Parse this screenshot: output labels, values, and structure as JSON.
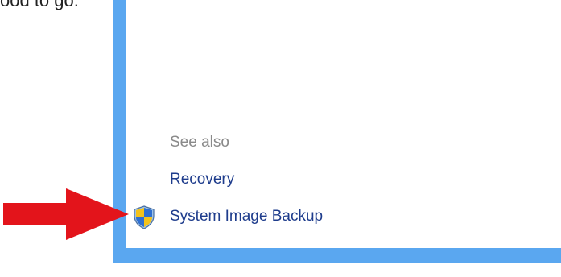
{
  "caption": {
    "text": "ood to go."
  },
  "see_also": {
    "heading": "See also",
    "links": [
      {
        "label": "Recovery",
        "icon": ""
      },
      {
        "label": "System Image Backup",
        "icon": "uac-shield-icon"
      }
    ]
  },
  "colors": {
    "frame": "#5aa7f0",
    "arrow": "#e3141b",
    "link": "#1e3c8c",
    "heading": "#8a8a8a"
  }
}
